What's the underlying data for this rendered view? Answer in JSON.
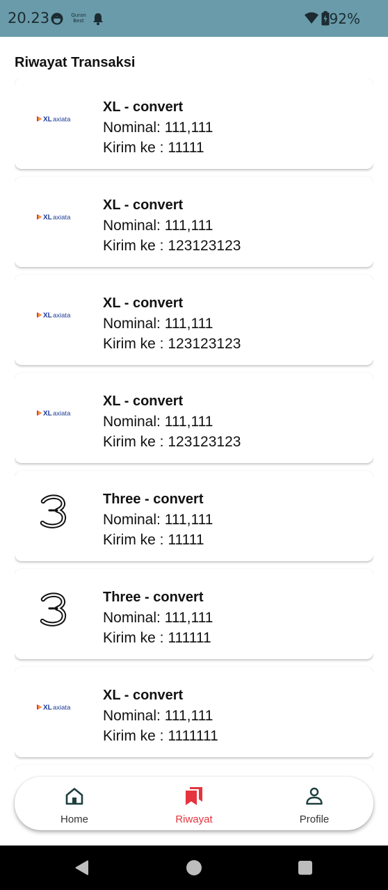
{
  "status_bar": {
    "time": "20.23",
    "notification_icons": [
      "face-icon",
      "quran-best-icon",
      "bell-icon"
    ],
    "quran_badge_line1": "Quran",
    "quran_badge_line2": "Best",
    "right_icons": [
      "wifi-icon",
      "battery-icon"
    ],
    "battery_percent": "92%"
  },
  "page": {
    "title": "Riwayat Transaksi"
  },
  "transactions": [
    {
      "logo": "xl-axiata-logo",
      "title": "XL - convert",
      "nominal": "Nominal: 111,111",
      "recipient": "Kirim ke : 11111"
    },
    {
      "logo": "xl-axiata-logo",
      "title": "XL - convert",
      "nominal": "Nominal: 111,111",
      "recipient": "Kirim ke : 123123123"
    },
    {
      "logo": "xl-axiata-logo",
      "title": "XL - convert",
      "nominal": "Nominal: 111,111",
      "recipient": "Kirim ke : 123123123"
    },
    {
      "logo": "xl-axiata-logo",
      "title": "XL - convert",
      "nominal": "Nominal: 111,111",
      "recipient": "Kirim ke : 123123123"
    },
    {
      "logo": "three-logo",
      "title": "Three - convert",
      "nominal": "Nominal: 111,111",
      "recipient": "Kirim ke : 11111"
    },
    {
      "logo": "three-logo",
      "title": "Three - convert",
      "nominal": "Nominal: 111,111",
      "recipient": "Kirim ke : 111111"
    },
    {
      "logo": "xl-axiata-logo",
      "title": "XL - convert",
      "nominal": "Nominal: 111,111",
      "recipient": "Kirim ke : 1111111"
    }
  ],
  "bottom_nav": {
    "items": [
      {
        "label": "Home",
        "icon": "home-icon",
        "active": false
      },
      {
        "label": "Riwayat",
        "icon": "bookmarks-icon",
        "active": true
      },
      {
        "label": "Profile",
        "icon": "person-icon",
        "active": false
      }
    ]
  },
  "system_nav": {
    "buttons": [
      "back-icon",
      "home-circle-icon",
      "recents-icon"
    ]
  },
  "colors": {
    "status_bar_bg": "#6a9baa",
    "accent_active": "#e5343d",
    "xl_logo_blue": "#1d3c96",
    "xl_logo_red": "#e5343d",
    "xl_logo_yellow": "#f4b81d"
  }
}
